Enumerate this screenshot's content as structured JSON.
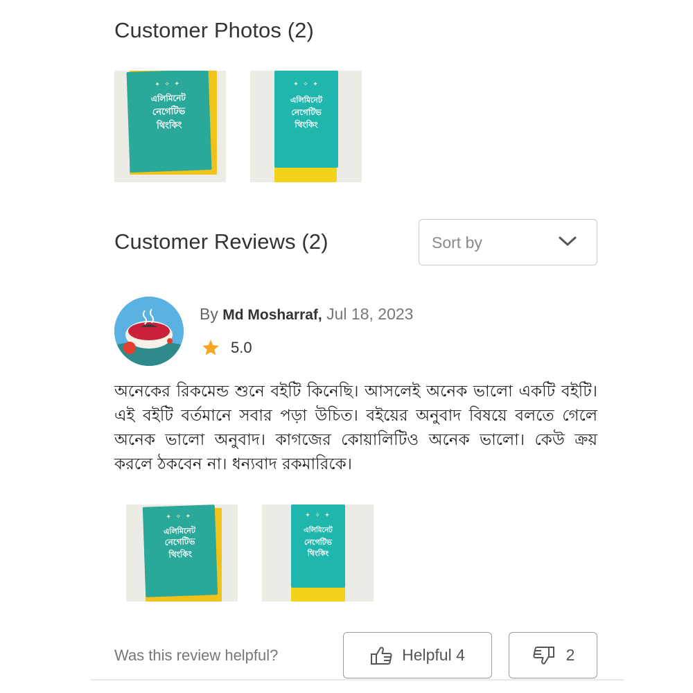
{
  "photos_section": {
    "title": "Customer Photos (2)",
    "photos": [
      {
        "cover_lines": [
          "এলিমিনেট",
          "নেগেটিভ",
          "থিংকিং"
        ],
        "cover_color": "#2aa89a"
      },
      {
        "cover_lines": [
          "এলিমিনেট",
          "নেগেটিভ",
          "থিংকিং"
        ],
        "cover_color": "#1fb7ad"
      }
    ]
  },
  "reviews_section": {
    "title": "Customer Reviews (2)",
    "sort": {
      "label": "Sort by",
      "icon": "chevron-down-icon"
    }
  },
  "review": {
    "by_prefix": "By",
    "author": "Md Mosharraf,",
    "date": "Jul 18, 2023",
    "rating": "5.0",
    "rating_icon": "star-icon",
    "star_color": "#f5a623",
    "body": "অনেকের রিকমেন্ড শুনে বইটি কিনেছি। আসলেই অনেক ভালো একটি বইটি। এই বইটি বর্তমানে সবার পড়া উচিত। বইয়ের অনুবাদ বিষয়ে বলতে গেলে অনেক ভালো অনুবাদ। কাগজের কোয়ালিটিও অনেক ভালো। কেউ ক্রয় করলে ঠকবেন না। ধন্যবাদ রকমারিকে।",
    "photos": [
      {
        "cover_lines": [
          "এলিমিনেট",
          "নেগেটিভ",
          "থিংকিং"
        ]
      },
      {
        "cover_lines": [
          "এলিমিনেট",
          "নেগেটিভ",
          "থিংকিং"
        ]
      }
    ]
  },
  "feedback": {
    "question": "Was this review helpful?",
    "helpful_label": "Helpful 4",
    "helpful_icon": "thumbs-up-icon",
    "unhelpful_count": "2",
    "unhelpful_icon": "thumbs-down-icon"
  }
}
